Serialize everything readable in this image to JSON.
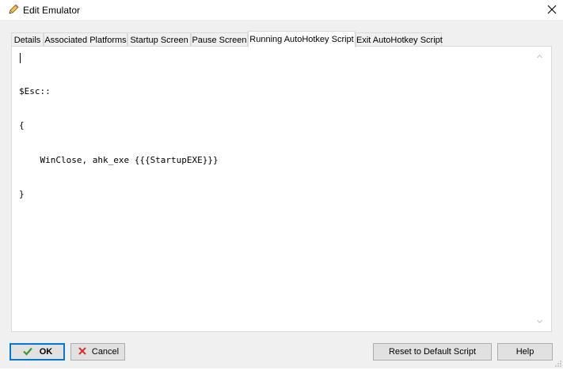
{
  "window": {
    "title": "Edit Emulator",
    "title_icon": "pencil-icon",
    "close_icon": "close-icon"
  },
  "tabs": [
    {
      "label": "Details"
    },
    {
      "label": "Associated Platforms"
    },
    {
      "label": "Startup Screen"
    },
    {
      "label": "Pause Screen"
    },
    {
      "label": "Running AutoHotkey Script",
      "selected": true
    },
    {
      "label": "Exit AutoHotkey Script"
    }
  ],
  "editor": {
    "lines": [
      "$Esc::",
      "{",
      "    WinClose, ahk_exe {{{StartupEXE}}}",
      "}"
    ]
  },
  "footer": {
    "ok_label": "OK",
    "ok_icon": "checkmark-icon",
    "cancel_label": "Cancel",
    "cancel_icon": "x-icon",
    "reset_label": "Reset to Default Script",
    "help_label": "Help"
  },
  "colors": {
    "ok_icon": "#3a9a2f",
    "cancel_icon": "#d32f2f",
    "default_button_border": "#0078d7",
    "tab_border": "#d9d9d9",
    "window_bg": "#f0f0f0"
  }
}
